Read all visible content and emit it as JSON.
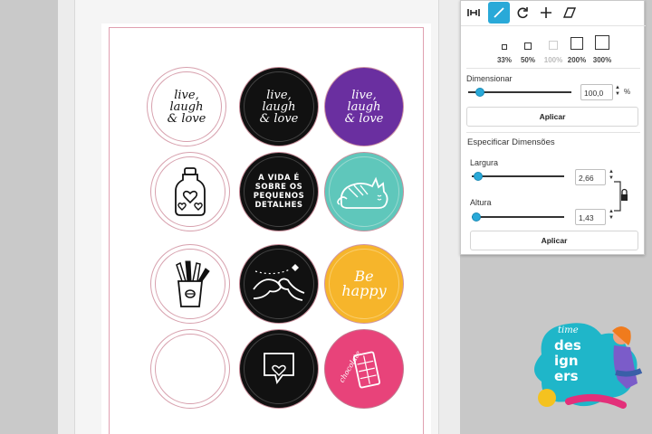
{
  "stickers": {
    "live_laugh_love": [
      "live,",
      "laugh",
      "& love"
    ],
    "vida_text": [
      "A VIDA É",
      "SOBRE OS",
      "PEQUENOS",
      "DETALHES"
    ],
    "be_happy": [
      "Be",
      "happy"
    ],
    "chocolate": "chocolate"
  },
  "panel": {
    "zoom_options": [
      "33%",
      "50%",
      "100%",
      "200%",
      "300%"
    ],
    "resize_label": "Dimensionar",
    "resize_value": "100,0",
    "resize_unit": "%",
    "apply_label": "Aplicar",
    "specify_label": "Especificar Dimensões",
    "width_label": "Largura",
    "width_value": "2,66",
    "height_label": "Altura",
    "height_value": "1,43",
    "apply2_label": "Aplicar"
  },
  "logo": {
    "word1": "des",
    "word2": "ign",
    "word3": "ers",
    "tag": "time"
  },
  "colors": {
    "accent": "#29a9d8",
    "purple": "#6a2fa0",
    "teal": "#5fc7bb",
    "yellow": "#f6b52b",
    "pink": "#e8437a"
  }
}
